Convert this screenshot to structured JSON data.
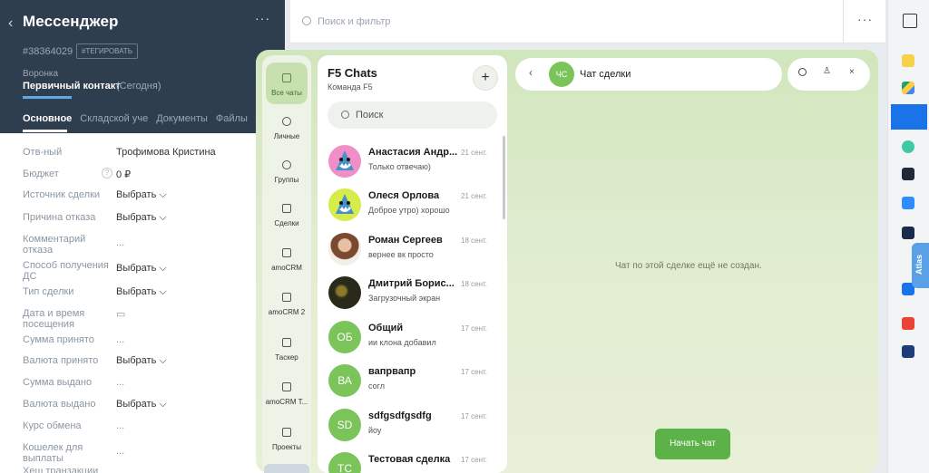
{
  "crm": {
    "title": "Мессенджер",
    "more": "···",
    "deal_id": "#38364029",
    "tag_button": "#ТЕГИРОВАТЬ",
    "funnel_label": "Воронка",
    "stage": "Первичный контакт",
    "stage_date": "(Сегодня)",
    "tabs": [
      "Основное",
      "Складской уче",
      "Документы",
      "Файлы"
    ],
    "fields": [
      {
        "label": "Отв-ный",
        "value": "Трофимова Кристина"
      },
      {
        "label": "Бюджет",
        "value": "0 ₽"
      },
      {
        "label": "Источник сделки",
        "value": "Выбрать ⌵"
      },
      {
        "label": "Причина отказа",
        "value": "Выбрать ⌵"
      },
      {
        "label": "Комментарий отказа",
        "value": "..."
      },
      {
        "label": "Способ получения ДС",
        "value": "Выбрать ⌵"
      },
      {
        "label": "Тип сделки",
        "value": "Выбрать ⌵"
      },
      {
        "label": "Дата и время посещения",
        "value": "▭"
      },
      {
        "label": "Сумма принято",
        "value": "..."
      },
      {
        "label": "Валюта принято",
        "value": "Выбрать ⌵"
      },
      {
        "label": "Сумма выдано",
        "value": "..."
      },
      {
        "label": "Валюта выдано",
        "value": "Выбрать ⌵"
      },
      {
        "label": "Курс обмена",
        "value": "..."
      },
      {
        "label": "Кошелек для выплаты",
        "value": "..."
      },
      {
        "label": "Хеш транзакции",
        "value": ""
      }
    ]
  },
  "topbar": {
    "search_placeholder": "Поиск и фильтр",
    "more": "···"
  },
  "sidebar": {
    "atlas": "Atlas"
  },
  "nav": [
    {
      "label": "Все чаты",
      "icon": "home-icon"
    },
    {
      "label": "Личные",
      "icon": "person-icon"
    },
    {
      "label": "Группы",
      "icon": "group-icon"
    },
    {
      "label": "Сделки",
      "icon": "deals-icon"
    },
    {
      "label": "amoCRM",
      "icon": "amocrm-icon"
    },
    {
      "label": "amoCRM 2",
      "icon": "amocrm-icon"
    },
    {
      "label": "Таскер",
      "icon": "tasker-icon"
    },
    {
      "label": "amoCRM T...",
      "icon": "amocrm-icon"
    },
    {
      "label": "Проекты",
      "icon": "projects-icon"
    }
  ],
  "chat_list": {
    "title": "F5 Chats",
    "subtitle": "Команда F5",
    "plus": "+",
    "search_placeholder": "Поиск",
    "chats": [
      {
        "name": "Анастасия Андр...",
        "date": "21 сент.",
        "message": "Только отвечаю)",
        "avatar": "shark"
      },
      {
        "name": "Олеся Орлова",
        "date": "21 сент.",
        "message": "Доброе утро) хорошо",
        "avatar": "shark"
      },
      {
        "name": "Роман Сергеев",
        "date": "18 сент.",
        "message": "вернее вк просто",
        "avatar": "photo"
      },
      {
        "name": "Дмитрий Борис...",
        "date": "18 сент.",
        "message": "Загрузочный экран",
        "avatar": "photo-dark"
      },
      {
        "name": "Общий",
        "date": "17 сент.",
        "message": "ии клона добавил",
        "initials": "ОБ"
      },
      {
        "name": "вапрвапр",
        "date": "17 сент.",
        "message": "согл",
        "initials": "ВА"
      },
      {
        "name": "sdfgsdfgsdfg",
        "date": "17 сент.",
        "message": "йоу",
        "initials": "SD"
      },
      {
        "name": "Тестовая сделка",
        "date": "17 сент.",
        "message": "",
        "initials": "ТС"
      }
    ]
  },
  "chat_view": {
    "back": "‹",
    "avatar_initials": "ЧС",
    "title": "Чат сделки",
    "empty_note": "Чат по этой сделке ещё не создан.",
    "start_button": "Начать чат",
    "close": "×"
  },
  "colors": {
    "accent_green": "#5cb249",
    "crm_header": "#2f3e4e",
    "avatar_green": "#7ac45a"
  }
}
